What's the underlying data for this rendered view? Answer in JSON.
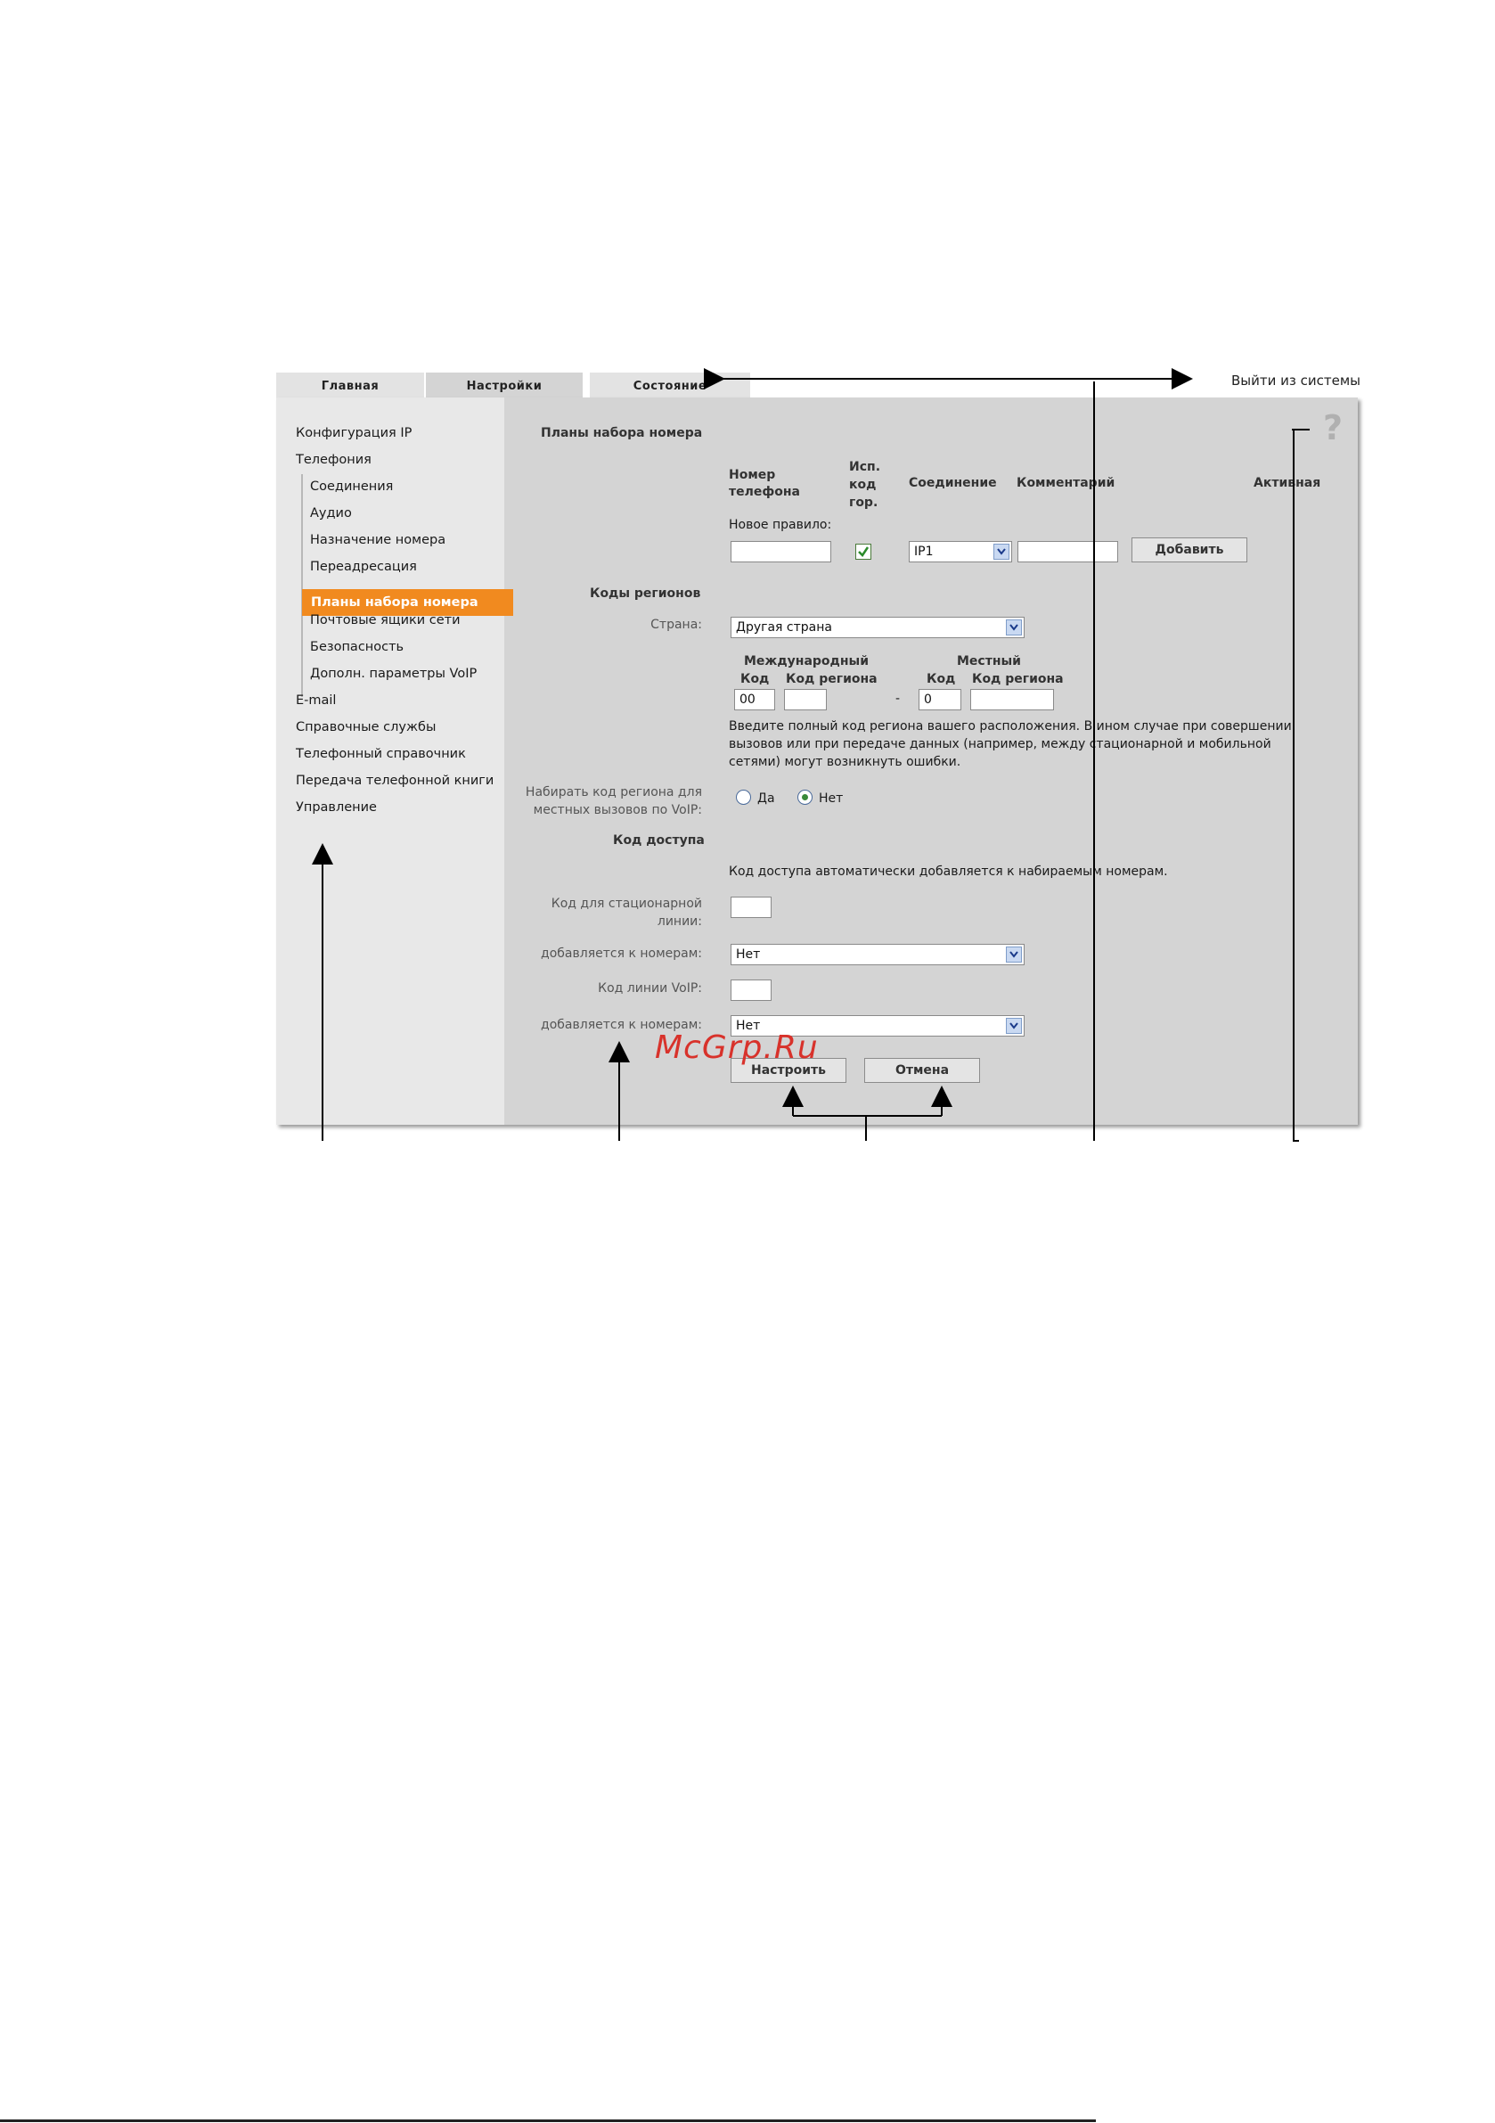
{
  "tabs": [
    {
      "label": "Главная"
    },
    {
      "label": "Настройки"
    },
    {
      "label": "Состояние"
    }
  ],
  "logout_label": "Выйти из системы",
  "help_glyph": "?",
  "nav": {
    "items": [
      {
        "label": "Конфигурация IP"
      },
      {
        "label": "Телефония"
      },
      {
        "label": "Соединения"
      },
      {
        "label": "Аудио"
      },
      {
        "label": "Назначение номера"
      },
      {
        "label": "Переадресация"
      },
      {
        "label": "Планы набора номера"
      },
      {
        "label": "Почтовые ящики сети"
      },
      {
        "label": "Безопасность"
      },
      {
        "label": "Дополн. параметры VoIP"
      },
      {
        "label": "E-mail"
      },
      {
        "label": "Справочные службы"
      },
      {
        "label": "Телефонный справочник"
      },
      {
        "label": "Передача телефонной книги"
      },
      {
        "label": "Управление"
      }
    ]
  },
  "dialplans": {
    "title": "Планы набора номера",
    "col_phone": "Номер телефона",
    "col_use_code": "Исп. код гор.",
    "col_connection": "Соединение",
    "col_comment": "Комментарий",
    "col_active": "Активная",
    "new_rule_label": "Новое правило:",
    "phone_value": "",
    "use_code_checked": true,
    "connection_value": "IP1",
    "comment_value": "",
    "add_button": "Добавить"
  },
  "area_codes": {
    "title": "Коды регионов",
    "country_label": "Страна:",
    "country_value": "Другая страна",
    "international_label": "Международный",
    "local_label": "Местный",
    "code_label": "Код",
    "region_code_label": "Код региона",
    "intl_code_value": "00",
    "intl_region_value": "",
    "dash": "-",
    "local_code_value": "0",
    "local_region_value": "",
    "info_text_1": "Введите полный код региона вашего расположения. В ином случае при совершении",
    "info_text_2": "вызовов или при передаче данных (например, между стационарной и мобильной",
    "info_text_3": "сетями) могут возникнуть ошибки.",
    "dial_label_1": "Набирать код региона для",
    "dial_label_2": "местных вызовов по VoIP:",
    "yes_label": "Да",
    "no_label": "Нет",
    "dial_value": "Нет"
  },
  "access_code": {
    "title": "Код доступа",
    "info_text": "Код доступа автоматически добавляется к набираемым номерам.",
    "fixed_label_1": "Код для стационарной",
    "fixed_label_2": "линии:",
    "fixed_value": "",
    "fixed_applies_label": "добавляется к номерам:",
    "fixed_applies_value": "Нет",
    "voip_label": "Код линии VoIP:",
    "voip_value": "",
    "voip_applies_label": "добавляется к номерам:",
    "voip_applies_value": "Нет"
  },
  "buttons": {
    "apply": "Настроить",
    "cancel": "Отмена"
  },
  "watermark": "McGrp.Ru"
}
